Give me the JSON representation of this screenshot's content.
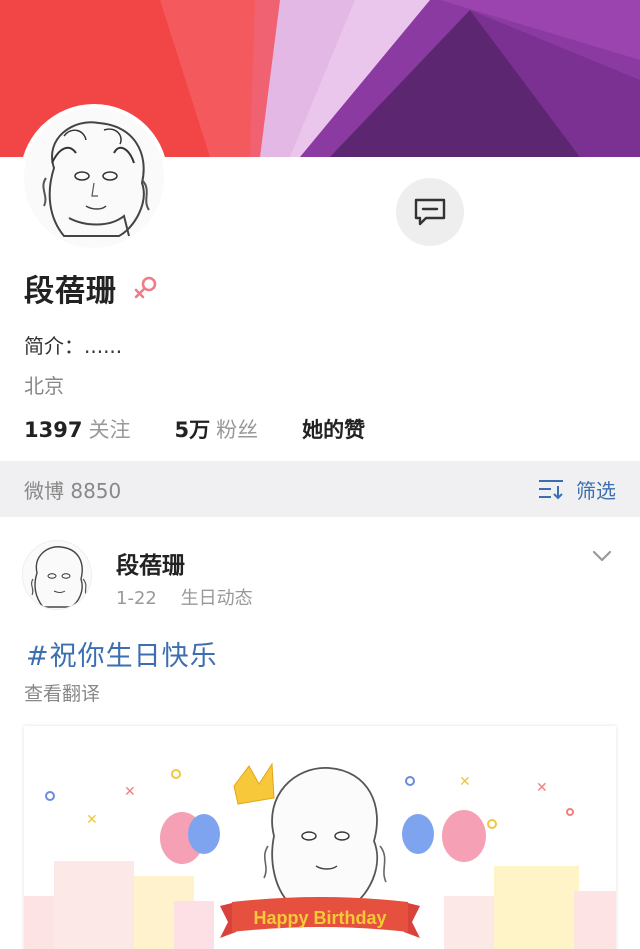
{
  "profile": {
    "name": "段蓓珊",
    "gender_icon": "female-symbol-icon",
    "bio": "简介：......",
    "location": "北京",
    "stats": {
      "following_num": "1397",
      "following_label": "关注",
      "followers_num": "5万",
      "followers_label": "粉丝",
      "likes_label": "她的赞"
    },
    "message_icon": "message-icon"
  },
  "feed_bar": {
    "count_label": "微博 8850",
    "filter_label": "筛选",
    "filter_icon": "filter-icon"
  },
  "post": {
    "author": "段蓓珊",
    "date": "1-22",
    "source": "生日动态",
    "hashtag": "#祝你生日快乐",
    "translate_label": "查看翻译",
    "banner_text": "Happy Birthday"
  },
  "colors": {
    "accent": "#3b6fb0",
    "banner_red": "#f14a4a",
    "banner_purple": "#7b2d8e"
  }
}
